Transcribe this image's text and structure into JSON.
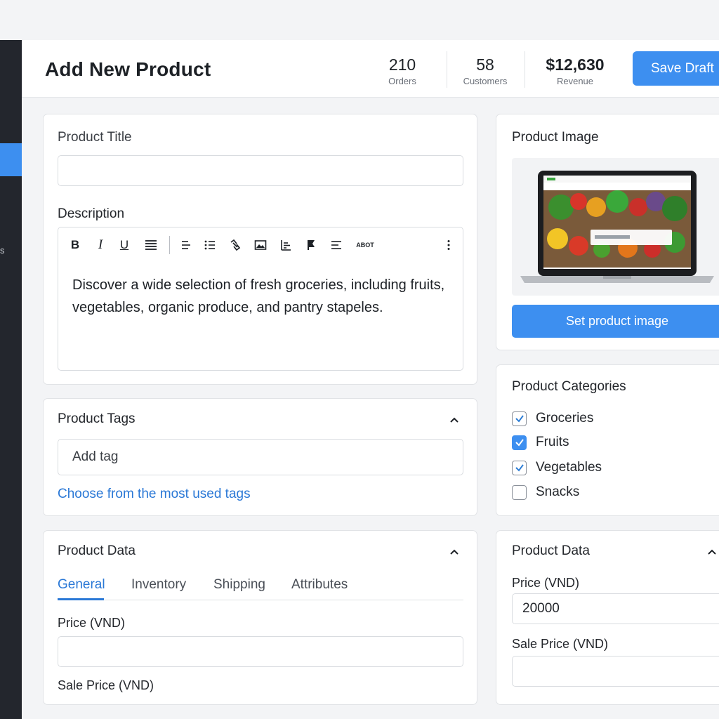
{
  "header": {
    "title": "Add New Product",
    "stats": [
      {
        "value": "210",
        "label": "Orders"
      },
      {
        "value": "58",
        "label": "Customers"
      },
      {
        "value": "$12,630",
        "label": "Revenue"
      }
    ],
    "save_label": "Save Draft"
  },
  "sidebar": {
    "partial_label": "s"
  },
  "title_card": {
    "label": "Product Title",
    "value": "",
    "description_label": "Description",
    "toolbar": {
      "bold": "B",
      "italic": "I",
      "underline": "U",
      "more": "ABOT",
      "icons": [
        "align-justify-icon",
        "align-left-icon",
        "bullet-list-icon",
        "link-icon",
        "image-icon",
        "chart-icon",
        "flag-icon",
        "align-right-icon",
        "more-vertical-icon"
      ]
    },
    "description_text": "Discover a wide selection of fresh groceries, including fruits, vegetables, organic produce, and pantry stapeles."
  },
  "tags_card": {
    "title": "Product Tags",
    "input_value": "Add tag",
    "link_label": "Choose from the most used tags"
  },
  "data_card_left": {
    "title": "Product Data",
    "tabs": [
      "General",
      "Inventory",
      "Shipping",
      "Attributes"
    ],
    "active_tab": "General",
    "price_label": "Price (VND)",
    "price_value": "",
    "sale_label": "Sale Price (VND)"
  },
  "image_card": {
    "title": "Product Image",
    "button_label": "Set product image",
    "accent": "#3d8ff0"
  },
  "categories_card": {
    "title": "Product Categories",
    "items": [
      {
        "label": "Groceries",
        "checked": true,
        "style": "outline"
      },
      {
        "label": "Fruits",
        "checked": true,
        "style": "filled"
      },
      {
        "label": "Vegetables",
        "checked": true,
        "style": "outline"
      },
      {
        "label": "Snacks",
        "checked": false,
        "style": "outline"
      }
    ]
  },
  "data_card_right": {
    "title": "Product Data",
    "price_label": "Price (VND)",
    "price_value": "20000",
    "sale_label": "Sale Price (VND)",
    "sale_value": ""
  }
}
